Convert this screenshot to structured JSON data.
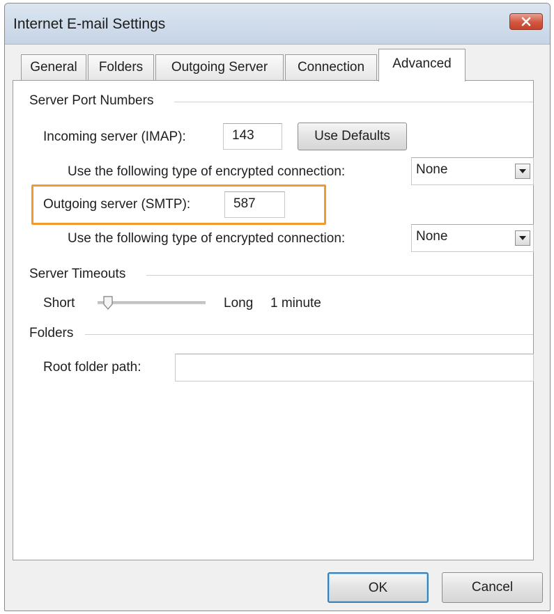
{
  "window": {
    "title": "Internet E-mail Settings"
  },
  "tabs": [
    {
      "label": "General"
    },
    {
      "label": "Folders"
    },
    {
      "label": "Outgoing Server"
    },
    {
      "label": "Connection"
    },
    {
      "label": "Advanced"
    }
  ],
  "active_tab": "Advanced",
  "ports": {
    "group_label": "Server Port Numbers",
    "incoming_label": "Incoming server (IMAP):",
    "incoming_value": "143",
    "use_defaults_label": "Use Defaults",
    "incoming_encryption_label": "Use the following type of encrypted connection:",
    "incoming_encryption_value": "None",
    "outgoing_label": "Outgoing server (SMTP):",
    "outgoing_value": "587",
    "outgoing_encryption_label": "Use the following type of encrypted connection:",
    "outgoing_encryption_value": "None"
  },
  "timeouts": {
    "group_label": "Server Timeouts",
    "short_label": "Short",
    "long_label": "Long",
    "value_text": "1 minute",
    "slider_fraction": 0.05
  },
  "folders": {
    "group_label": "Folders",
    "root_label": "Root folder path:",
    "root_value": ""
  },
  "footer": {
    "ok_label": "OK",
    "cancel_label": "Cancel"
  },
  "colors": {
    "highlight": "#f29a2e",
    "close_button": "#d2563f",
    "ok_focus": "#3c7fb1"
  }
}
